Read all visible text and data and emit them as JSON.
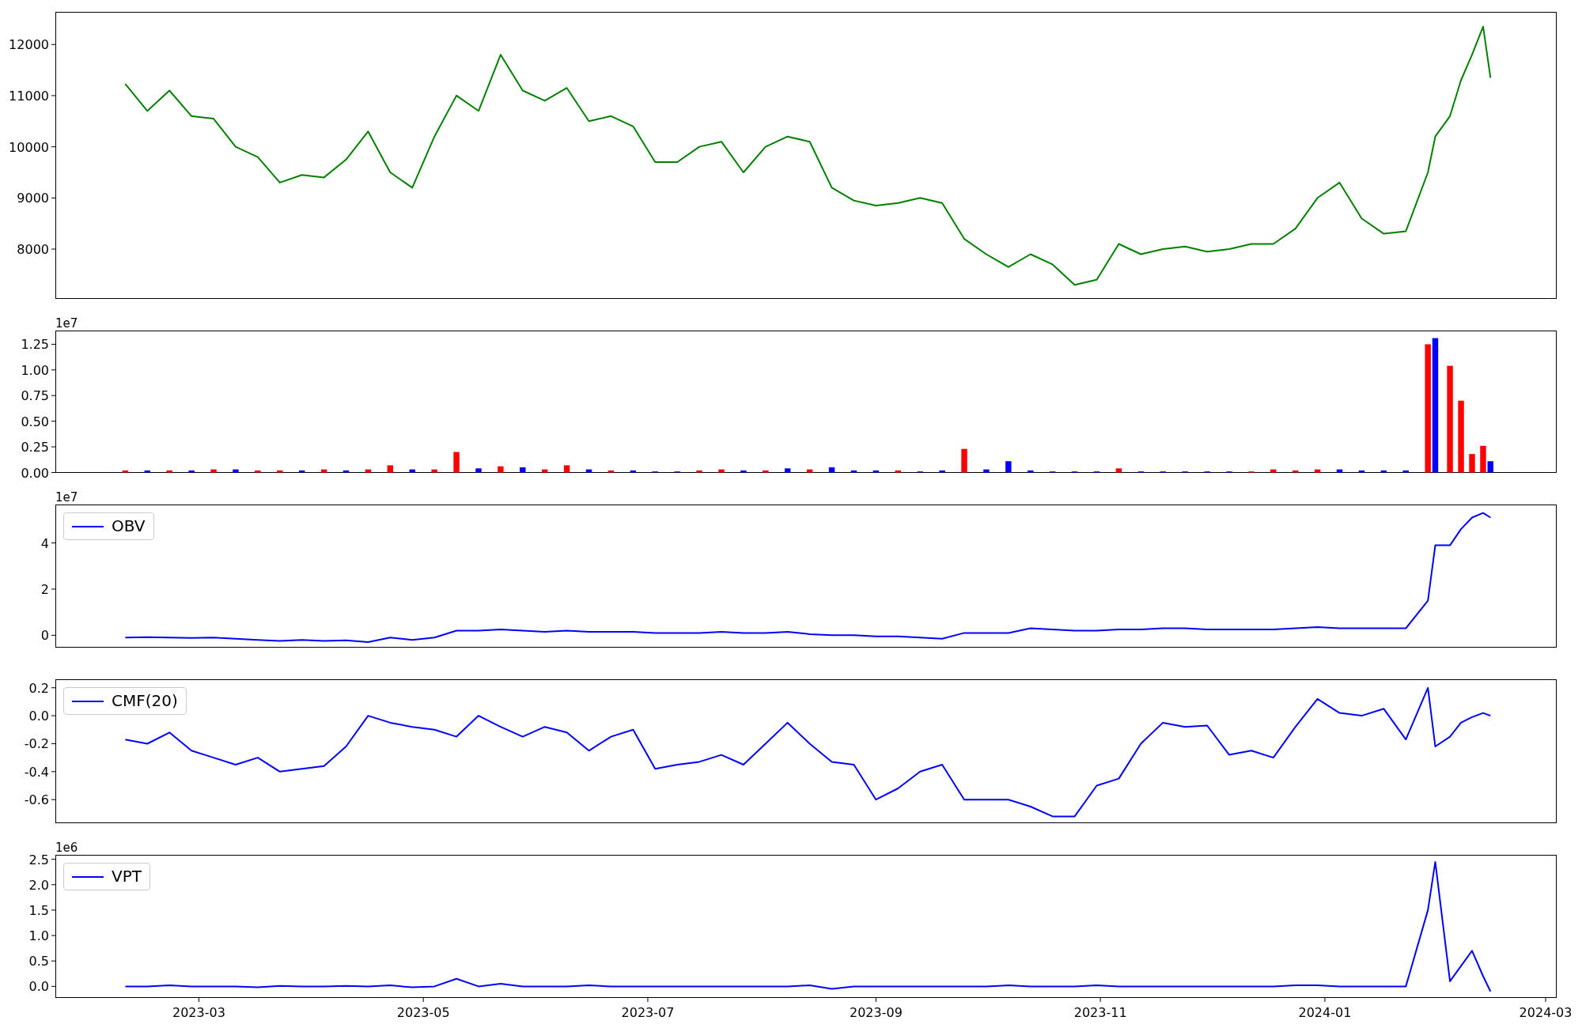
{
  "figure": {
    "panels": [
      {
        "chart_data": {
          "type": "line",
          "x": [
            "2023-02-09",
            "2023-02-15",
            "2023-02-21",
            "2023-02-27",
            "2023-03-05",
            "2023-03-11",
            "2023-03-17",
            "2023-03-23",
            "2023-03-29",
            "2023-04-04",
            "2023-04-10",
            "2023-04-16",
            "2023-04-22",
            "2023-04-28",
            "2023-05-04",
            "2023-05-10",
            "2023-05-16",
            "2023-05-22",
            "2023-05-28",
            "2023-06-03",
            "2023-06-09",
            "2023-06-15",
            "2023-06-21",
            "2023-06-27",
            "2023-07-03",
            "2023-07-09",
            "2023-07-15",
            "2023-07-21",
            "2023-07-27",
            "2023-08-02",
            "2023-08-08",
            "2023-08-14",
            "2023-08-20",
            "2023-08-26",
            "2023-09-01",
            "2023-09-07",
            "2023-09-13",
            "2023-09-19",
            "2023-09-25",
            "2023-10-01",
            "2023-10-07",
            "2023-10-13",
            "2023-10-19",
            "2023-10-25",
            "2023-10-31",
            "2023-11-06",
            "2023-11-12",
            "2023-11-18",
            "2023-11-24",
            "2023-11-30",
            "2023-12-06",
            "2023-12-12",
            "2023-12-18",
            "2023-12-24",
            "2023-12-30",
            "2024-01-05",
            "2024-01-11",
            "2024-01-17",
            "2024-01-23",
            "2024-01-29",
            "2024-01-31",
            "2024-02-04",
            "2024-02-07",
            "2024-02-10",
            "2024-02-13",
            "2024-02-15"
          ],
          "series": [
            {
              "color": "#008000",
              "values": [
                11230,
                10700,
                11100,
                10600,
                10550,
                10000,
                9800,
                9300,
                9450,
                9400,
                9750,
                10300,
                9500,
                9200,
                10200,
                11000,
                10700,
                11800,
                11100,
                10900,
                11150,
                10500,
                10600,
                10400,
                9700,
                9700,
                10000,
                10100,
                9500,
                10000,
                10200,
                10100,
                9200,
                8950,
                8850,
                8900,
                9000,
                8900,
                8200,
                7900,
                7650,
                7900,
                7700,
                7300,
                7400,
                8100,
                7900,
                8000,
                8050,
                7950,
                8000,
                8100,
                8100,
                8400,
                9000,
                9300,
                8600,
                8300,
                8350,
                9500,
                10200,
                10600,
                11300,
                11800,
                12350,
                11350
              ]
            }
          ],
          "xlim": [
            "2023-01-21",
            "2024-03-04"
          ],
          "ylim": [
            7034,
            12630
          ],
          "yticks": [
            8000,
            9000,
            10000,
            11000,
            12000
          ]
        }
      },
      {
        "offset_label": "1e7",
        "chart_data": {
          "type": "bar",
          "x": [
            "2023-02-09",
            "2023-02-15",
            "2023-02-21",
            "2023-02-27",
            "2023-03-05",
            "2023-03-11",
            "2023-03-17",
            "2023-03-23",
            "2023-03-29",
            "2023-04-04",
            "2023-04-10",
            "2023-04-16",
            "2023-04-22",
            "2023-04-28",
            "2023-05-04",
            "2023-05-10",
            "2023-05-16",
            "2023-05-22",
            "2023-05-28",
            "2023-06-03",
            "2023-06-09",
            "2023-06-15",
            "2023-06-21",
            "2023-06-27",
            "2023-07-03",
            "2023-07-09",
            "2023-07-15",
            "2023-07-21",
            "2023-07-27",
            "2023-08-02",
            "2023-08-08",
            "2023-08-14",
            "2023-08-20",
            "2023-08-26",
            "2023-09-01",
            "2023-09-07",
            "2023-09-13",
            "2023-09-19",
            "2023-09-25",
            "2023-10-01",
            "2023-10-07",
            "2023-10-13",
            "2023-10-19",
            "2023-10-25",
            "2023-10-31",
            "2023-11-06",
            "2023-11-12",
            "2023-11-18",
            "2023-11-24",
            "2023-11-30",
            "2023-12-06",
            "2023-12-12",
            "2023-12-18",
            "2023-12-24",
            "2023-12-30",
            "2024-01-05",
            "2024-01-11",
            "2024-01-17",
            "2024-01-23",
            "2024-01-29",
            "2024-01-31",
            "2024-02-04",
            "2024-02-07",
            "2024-02-10",
            "2024-02-13",
            "2024-02-15"
          ],
          "series": [
            {
              "color": "#ff0000",
              "values": [
                0.02,
                null,
                0.02,
                null,
                0.03,
                null,
                0.02,
                0.02,
                null,
                0.03,
                null,
                0.03,
                0.07,
                null,
                0.03,
                0.2,
                null,
                0.06,
                null,
                0.03,
                0.07,
                null,
                0.02,
                null,
                null,
                null,
                0.02,
                0.03,
                null,
                0.02,
                null,
                0.03,
                null,
                null,
                null,
                0.02,
                null,
                null,
                0.23,
                null,
                null,
                null,
                null,
                null,
                null,
                0.04,
                null,
                null,
                null,
                null,
                null,
                0.01,
                0.03,
                0.02,
                0.03,
                null,
                null,
                null,
                null,
                1.25,
                null,
                1.04,
                0.7,
                0.18,
                0.26,
                null
              ]
            },
            {
              "color": "#0000ff",
              "values": [
                null,
                0.02,
                null,
                0.02,
                null,
                0.03,
                null,
                null,
                0.02,
                null,
                0.02,
                null,
                null,
                0.03,
                null,
                null,
                0.04,
                null,
                0.05,
                null,
                null,
                0.03,
                null,
                0.02,
                0.01,
                0.01,
                null,
                null,
                0.02,
                null,
                0.04,
                null,
                0.05,
                0.02,
                0.02,
                null,
                0.01,
                0.02,
                null,
                0.03,
                0.11,
                0.02,
                0.01,
                0.01,
                0.01,
                null,
                0.01,
                0.01,
                0.01,
                0.01,
                0.01,
                null,
                null,
                null,
                null,
                0.03,
                0.02,
                0.02,
                0.02,
                null,
                1.31,
                null,
                null,
                null,
                null,
                0.11
              ]
            }
          ],
          "xlim": [
            "2023-01-21",
            "2024-03-04"
          ],
          "ylim": [
            0,
            1.38
          ],
          "yticks": [
            {
              "value": 0,
              "label": "0.00"
            },
            {
              "value": 0.25,
              "label": "0.25"
            },
            {
              "value": 0.5,
              "label": "0.50"
            },
            {
              "value": 0.75,
              "label": "0.75"
            },
            {
              "value": 1,
              "label": "1.00"
            },
            {
              "value": 1.25,
              "label": "1.25"
            }
          ]
        }
      },
      {
        "offset_label": "1e7",
        "legend": true,
        "chart_data": {
          "type": "line",
          "x": [
            "2023-02-09",
            "2023-02-15",
            "2023-02-21",
            "2023-02-27",
            "2023-03-05",
            "2023-03-11",
            "2023-03-17",
            "2023-03-23",
            "2023-03-29",
            "2023-04-04",
            "2023-04-10",
            "2023-04-16",
            "2023-04-22",
            "2023-04-28",
            "2023-05-04",
            "2023-05-10",
            "2023-05-16",
            "2023-05-22",
            "2023-05-28",
            "2023-06-03",
            "2023-06-09",
            "2023-06-15",
            "2023-06-21",
            "2023-06-27",
            "2023-07-03",
            "2023-07-09",
            "2023-07-15",
            "2023-07-21",
            "2023-07-27",
            "2023-08-02",
            "2023-08-08",
            "2023-08-14",
            "2023-08-20",
            "2023-08-26",
            "2023-09-01",
            "2023-09-07",
            "2023-09-13",
            "2023-09-19",
            "2023-09-25",
            "2023-10-01",
            "2023-10-07",
            "2023-10-13",
            "2023-10-19",
            "2023-10-25",
            "2023-10-31",
            "2023-11-06",
            "2023-11-12",
            "2023-11-18",
            "2023-11-24",
            "2023-11-30",
            "2023-12-06",
            "2023-12-12",
            "2023-12-18",
            "2023-12-24",
            "2023-12-30",
            "2024-01-05",
            "2024-01-11",
            "2024-01-17",
            "2024-01-23",
            "2024-01-29",
            "2024-01-31",
            "2024-02-04",
            "2024-02-07",
            "2024-02-10",
            "2024-02-13",
            "2024-02-15"
          ],
          "series": [
            {
              "name": "OBV",
              "color": "#0000ff",
              "values": [
                -0.1,
                -0.08,
                -0.1,
                -0.12,
                -0.1,
                -0.15,
                -0.2,
                -0.25,
                -0.2,
                -0.25,
                -0.22,
                -0.3,
                -0.1,
                -0.2,
                -0.1,
                0.2,
                0.2,
                0.25,
                0.2,
                0.15,
                0.2,
                0.15,
                0.15,
                0.15,
                0.1,
                0.1,
                0.1,
                0.15,
                0.1,
                0.1,
                0.15,
                0.05,
                0.0,
                0.0,
                -0.05,
                -0.05,
                -0.1,
                -0.15,
                0.1,
                0.1,
                0.1,
                0.3,
                0.25,
                0.2,
                0.2,
                0.25,
                0.25,
                0.3,
                0.3,
                0.25,
                0.25,
                0.25,
                0.25,
                0.3,
                0.35,
                0.3,
                0.3,
                0.3,
                0.3,
                1.5,
                3.9,
                3.9,
                4.6,
                5.1,
                5.3,
                5.1
              ]
            }
          ],
          "xlim": [
            "2023-01-21",
            "2024-03-04"
          ],
          "ylim": [
            -0.52,
            5.65
          ],
          "yticks": [
            0,
            2,
            4
          ]
        }
      },
      {
        "legend": true,
        "chart_data": {
          "type": "line",
          "x": [
            "2023-02-09",
            "2023-02-15",
            "2023-02-21",
            "2023-02-27",
            "2023-03-05",
            "2023-03-11",
            "2023-03-17",
            "2023-03-23",
            "2023-03-29",
            "2023-04-04",
            "2023-04-10",
            "2023-04-16",
            "2023-04-22",
            "2023-04-28",
            "2023-05-04",
            "2023-05-10",
            "2023-05-16",
            "2023-05-22",
            "2023-05-28",
            "2023-06-03",
            "2023-06-09",
            "2023-06-15",
            "2023-06-21",
            "2023-06-27",
            "2023-07-03",
            "2023-07-09",
            "2023-07-15",
            "2023-07-21",
            "2023-07-27",
            "2023-08-02",
            "2023-08-08",
            "2023-08-14",
            "2023-08-20",
            "2023-08-26",
            "2023-09-01",
            "2023-09-07",
            "2023-09-13",
            "2023-09-19",
            "2023-09-25",
            "2023-10-01",
            "2023-10-07",
            "2023-10-13",
            "2023-10-19",
            "2023-10-25",
            "2023-10-31",
            "2023-11-06",
            "2023-11-12",
            "2023-11-18",
            "2023-11-24",
            "2023-11-30",
            "2023-12-06",
            "2023-12-12",
            "2023-12-18",
            "2023-12-24",
            "2023-12-30",
            "2024-01-05",
            "2024-01-11",
            "2024-01-17",
            "2024-01-23",
            "2024-01-29",
            "2024-01-31",
            "2024-02-04",
            "2024-02-07",
            "2024-02-10",
            "2024-02-13",
            "2024-02-15"
          ],
          "series": [
            {
              "name": "CMF(20)",
              "color": "#0000ff",
              "values": [
                -0.17,
                -0.2,
                -0.12,
                -0.25,
                -0.3,
                -0.35,
                -0.3,
                -0.4,
                -0.38,
                -0.36,
                -0.22,
                0.0,
                -0.05,
                -0.08,
                -0.1,
                -0.15,
                0.0,
                -0.08,
                -0.15,
                -0.08,
                -0.12,
                -0.25,
                -0.15,
                -0.1,
                -0.38,
                -0.35,
                -0.33,
                -0.28,
                -0.35,
                -0.2,
                -0.05,
                -0.2,
                -0.33,
                -0.35,
                -0.6,
                -0.52,
                -0.4,
                -0.35,
                -0.6,
                -0.6,
                -0.6,
                -0.65,
                -0.72,
                -0.72,
                -0.5,
                -0.45,
                -0.2,
                -0.05,
                -0.08,
                -0.07,
                -0.28,
                -0.25,
                -0.3,
                -0.08,
                0.12,
                0.02,
                0.0,
                0.05,
                -0.17,
                0.2,
                -0.22,
                -0.15,
                -0.05,
                -0.01,
                0.02,
                0.0
              ]
            }
          ],
          "xlim": [
            "2023-01-21",
            "2024-03-04"
          ],
          "ylim": [
            -0.766,
            0.258
          ],
          "yticks": [
            {
              "value": -0.6,
              "label": "-0.6"
            },
            {
              "value": -0.4,
              "label": "-0.4"
            },
            {
              "value": -0.2,
              "label": "-0.2"
            },
            {
              "value": 0,
              "label": "0.0"
            },
            {
              "value": 0.2,
              "label": "0.2"
            }
          ]
        }
      },
      {
        "offset_label": "1e6",
        "legend": true,
        "chart_data": {
          "type": "line",
          "x": [
            "2023-02-09",
            "2023-02-15",
            "2023-02-21",
            "2023-02-27",
            "2023-03-05",
            "2023-03-11",
            "2023-03-17",
            "2023-03-23",
            "2023-03-29",
            "2023-04-04",
            "2023-04-10",
            "2023-04-16",
            "2023-04-22",
            "2023-04-28",
            "2023-05-04",
            "2023-05-10",
            "2023-05-16",
            "2023-05-22",
            "2023-05-28",
            "2023-06-03",
            "2023-06-09",
            "2023-06-15",
            "2023-06-21",
            "2023-06-27",
            "2023-07-03",
            "2023-07-09",
            "2023-07-15",
            "2023-07-21",
            "2023-07-27",
            "2023-08-02",
            "2023-08-08",
            "2023-08-14",
            "2023-08-20",
            "2023-08-26",
            "2023-09-01",
            "2023-09-07",
            "2023-09-13",
            "2023-09-19",
            "2023-09-25",
            "2023-10-01",
            "2023-10-07",
            "2023-10-13",
            "2023-10-19",
            "2023-10-25",
            "2023-10-31",
            "2023-11-06",
            "2023-11-12",
            "2023-11-18",
            "2023-11-24",
            "2023-11-30",
            "2023-12-06",
            "2023-12-12",
            "2023-12-18",
            "2023-12-24",
            "2023-12-30",
            "2024-01-05",
            "2024-01-11",
            "2024-01-17",
            "2024-01-23",
            "2024-01-29",
            "2024-01-31",
            "2024-02-04",
            "2024-02-07",
            "2024-02-10",
            "2024-02-13",
            "2024-02-15"
          ],
          "series": [
            {
              "name": "VPT",
              "color": "#0000ff",
              "values": [
                0.0,
                0.0,
                0.02,
                0.0,
                0.0,
                0.0,
                -0.02,
                0.01,
                0.0,
                0.0,
                0.01,
                0.0,
                0.02,
                -0.02,
                0.0,
                0.15,
                0.0,
                0.05,
                0.0,
                0.0,
                0.0,
                0.02,
                0.0,
                0.0,
                0.0,
                0.0,
                0.0,
                0.0,
                0.0,
                0.0,
                0.0,
                0.02,
                -0.05,
                0.0,
                0.0,
                0.0,
                0.0,
                0.0,
                0.0,
                0.0,
                0.02,
                0.0,
                0.0,
                0.0,
                0.02,
                0.0,
                0.0,
                0.0,
                0.0,
                0.0,
                0.0,
                0.0,
                0.0,
                0.02,
                0.02,
                0.0,
                0.0,
                0.0,
                0.0,
                1.5,
                2.45,
                0.1,
                0.4,
                0.7,
                0.2,
                -0.1
              ]
            }
          ],
          "xlim": [
            "2023-01-21",
            "2024-03-04"
          ],
          "ylim": [
            -0.22,
            2.58
          ],
          "yticks": [
            {
              "value": 0,
              "label": "0.0"
            },
            {
              "value": 0.5,
              "label": "0.5"
            },
            {
              "value": 1,
              "label": "1.0"
            },
            {
              "value": 1.5,
              "label": "1.5"
            },
            {
              "value": 2,
              "label": "2.0"
            },
            {
              "value": 2.5,
              "label": "2.5"
            }
          ],
          "xticks": [
            {
              "value": "2023-03-01",
              "label": "2023-03"
            },
            {
              "value": "2023-05-01",
              "label": "2023-05"
            },
            {
              "value": "2023-07-01",
              "label": "2023-07"
            },
            {
              "value": "2023-09-01",
              "label": "2023-09"
            },
            {
              "value": "2023-11-01",
              "label": "2023-11"
            },
            {
              "value": "2024-01-01",
              "label": "2024-01"
            },
            {
              "value": "2024-03-01",
              "label": "2024-03"
            }
          ]
        }
      }
    ]
  }
}
